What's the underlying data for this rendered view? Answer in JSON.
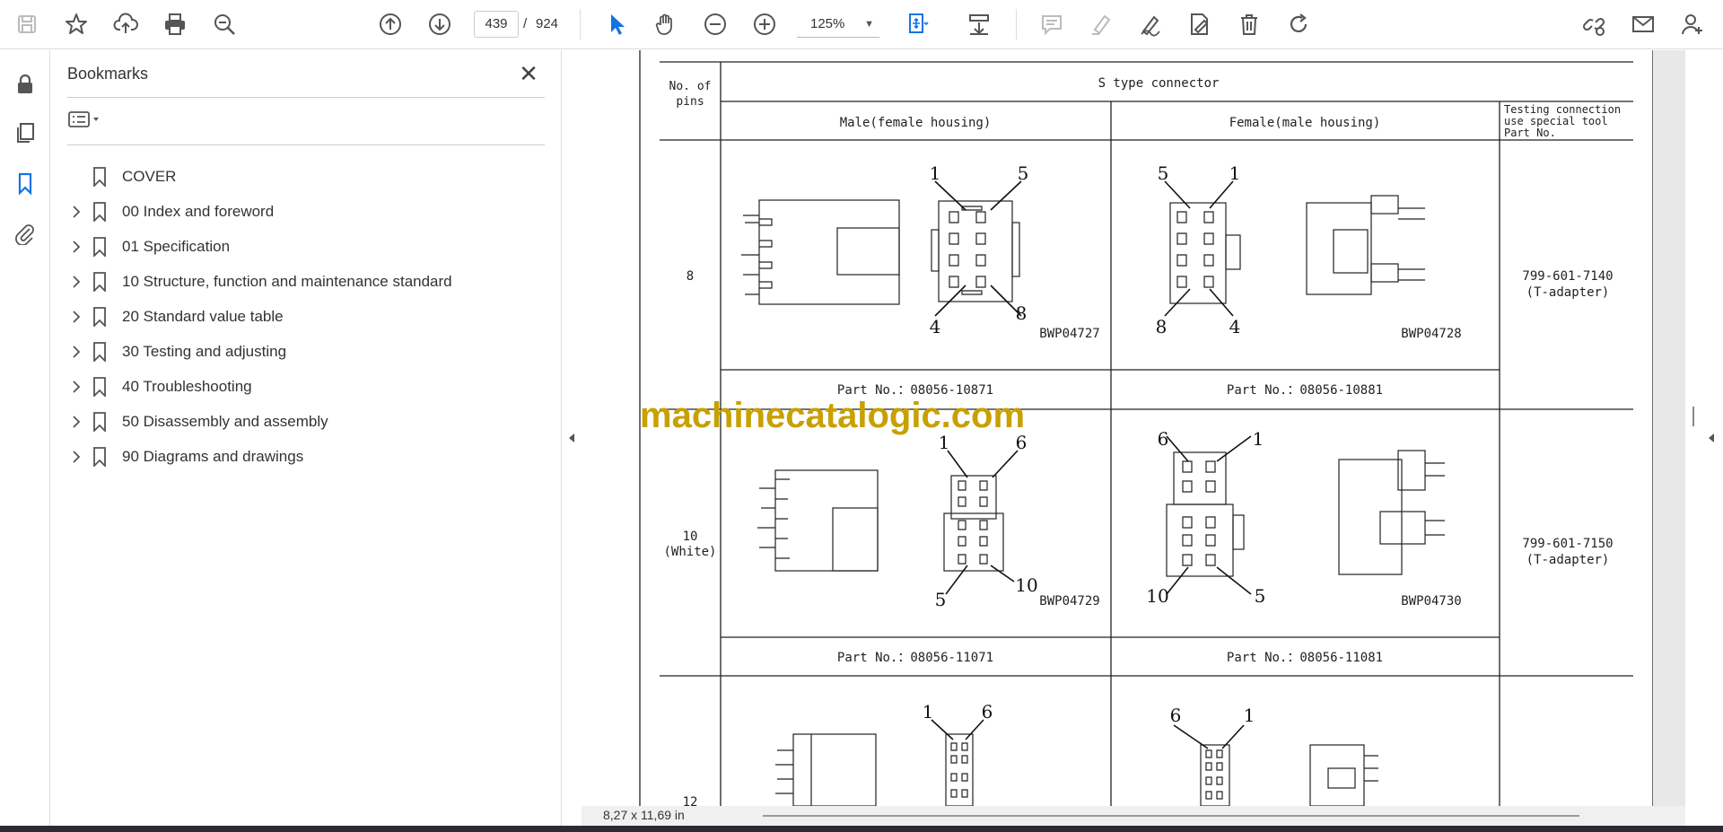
{
  "toolbar": {
    "icons": [
      "save-icon",
      "star-icon",
      "upload-icon",
      "print-icon",
      "zoom-search-icon",
      "prev-page-icon",
      "next-page-icon",
      "select-cursor-icon",
      "hand-icon",
      "zoom-out-icon",
      "zoom-in-icon",
      "fit-page-icon",
      "scroll-mode-icon",
      "comment-icon",
      "highlight-icon",
      "sign-icon",
      "fill-sign-icon",
      "delete-icon",
      "rotate-icon",
      "share-link-icon",
      "email-icon",
      "account-icon"
    ],
    "current_page": "439",
    "page_separator": "/",
    "total_pages": "924",
    "zoom": "125%"
  },
  "left_rail": {
    "icons": [
      "lock-icon",
      "pages-icon",
      "bookmark-icon",
      "attachment-icon"
    ]
  },
  "bookmarks": {
    "title": "Bookmarks",
    "items": [
      {
        "label": "COVER",
        "expandable": false
      },
      {
        "label": "00 Index and foreword",
        "expandable": true
      },
      {
        "label": "01 Specification",
        "expandable": true
      },
      {
        "label": "10 Structure, function and maintenance standard",
        "expandable": true
      },
      {
        "label": "20 Standard value table",
        "expandable": true
      },
      {
        "label": "30 Testing and adjusting",
        "expandable": true
      },
      {
        "label": "40 Troubleshooting",
        "expandable": true
      },
      {
        "label": "50 Disassembly and assembly",
        "expandable": true
      },
      {
        "label": "90 Diagrams and drawings",
        "expandable": true
      }
    ]
  },
  "document": {
    "header_pins_1": "No. of",
    "header_pins_2": "pins",
    "header_main": "S type connector",
    "header_male": "Male(female housing)",
    "header_female": "Female(male housing)",
    "header_tool_1": "Testing connection",
    "header_tool_2": "use special tool",
    "header_tool_3": "Part No.",
    "rows": [
      {
        "pins": "8",
        "pins_sub": "",
        "male_drawing": "BWP04727",
        "female_drawing": "BWP04728",
        "male_part": "Part No.：08056-10871",
        "female_part": "Part No.：08056-10881",
        "tool_no": "799-601-7140",
        "tool_name": "(T-adapter)",
        "male_labels": [
          "1",
          "5",
          "4",
          "8"
        ],
        "female_labels": [
          "5",
          "1",
          "8",
          "4"
        ]
      },
      {
        "pins": "10",
        "pins_sub": "(White)",
        "male_drawing": "BWP04729",
        "female_drawing": "BWP04730",
        "male_part": "Part No.：08056-11071",
        "female_part": "Part No.：08056-11081",
        "tool_no": "799-601-7150",
        "tool_name": "(T-adapter)",
        "male_labels": [
          "1",
          "6",
          "5",
          "10"
        ],
        "female_labels": [
          "6",
          "1",
          "10",
          "5"
        ]
      },
      {
        "pins": "12",
        "male_labels": [
          "1",
          "6"
        ],
        "female_labels": [
          "6",
          "1"
        ]
      }
    ],
    "watermark": "machinecatalogic.com"
  },
  "status": {
    "page_size": "8,27 x 11,69 in"
  },
  "colors": {
    "accent": "#1473e6",
    "watermark": "#c8a000"
  }
}
